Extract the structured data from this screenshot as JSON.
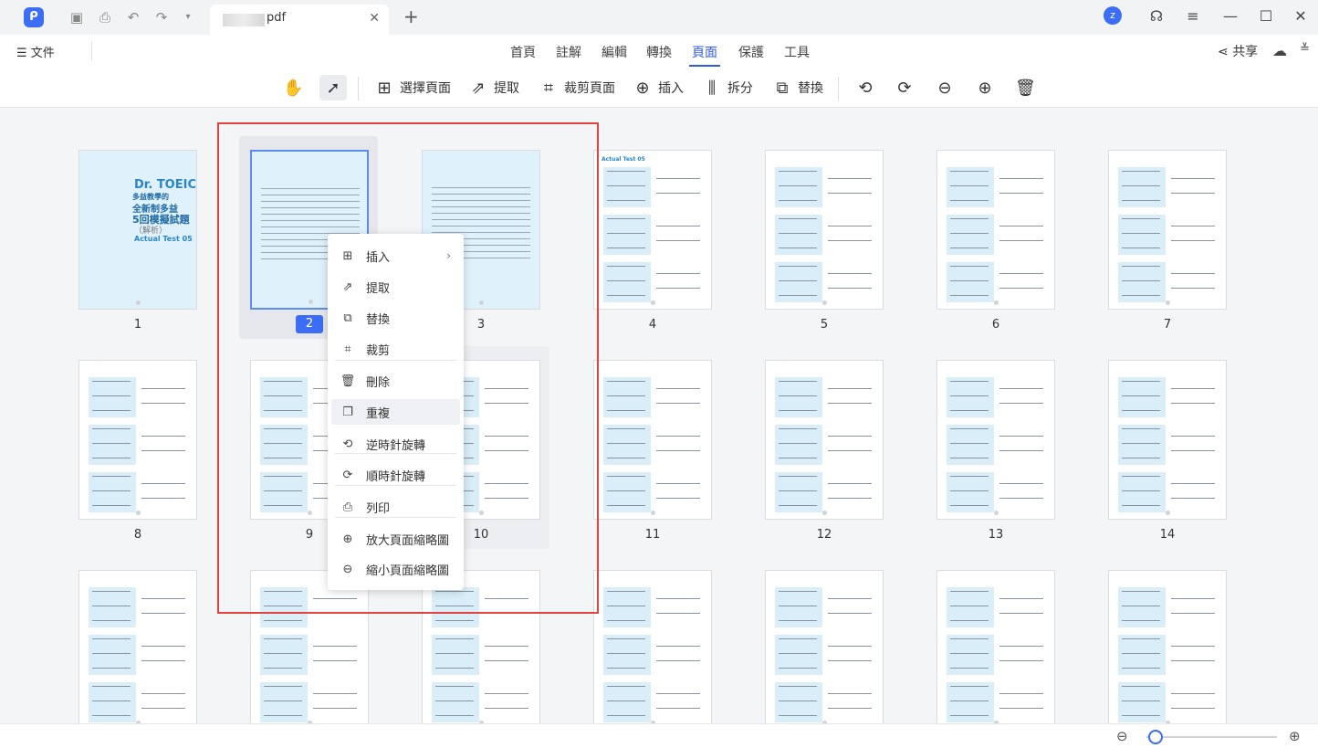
{
  "titlebar": {
    "tab_title": "pdf",
    "avatar_letter": "z"
  },
  "menubar": {
    "file": "文件",
    "nav": [
      "首頁",
      "註解",
      "編輯",
      "轉換",
      "頁面",
      "保護",
      "工具"
    ],
    "active_nav": "頁面",
    "share": "共享"
  },
  "toolbar": {
    "select_pages": "選擇頁面",
    "extract": "提取",
    "crop_pages": "裁剪頁面",
    "insert": "插入",
    "split": "拆分",
    "replace": "替換"
  },
  "pages": [
    "1",
    "2",
    "3",
    "4",
    "5",
    "6",
    "7",
    "8",
    "9",
    "10",
    "11",
    "12",
    "13",
    "14"
  ],
  "selected_page": "2",
  "cover": {
    "title": "Dr. TOEIC",
    "line1": "多益教學的",
    "line2": "全新制多益",
    "line3": "5回模擬試題",
    "tag": "（解析）",
    "test": "Actual Test 05"
  },
  "page4_label": "Actual Test 05",
  "context_menu": [
    {
      "label": "插入",
      "icon": "insert-icon",
      "submenu": true
    },
    {
      "label": "提取",
      "icon": "extract-icon"
    },
    {
      "label": "替換",
      "icon": "replace-icon"
    },
    {
      "label": "裁剪",
      "icon": "crop-icon"
    },
    {
      "label": "刪除",
      "icon": "delete-icon"
    },
    {
      "label": "重複",
      "icon": "duplicate-icon"
    },
    {
      "label": "逆時針旋轉",
      "icon": "rotate-ccw-icon"
    },
    {
      "label": "順時針旋轉",
      "icon": "rotate-cw-icon"
    },
    {
      "label": "列印",
      "icon": "print-icon"
    },
    {
      "label": "放大頁面縮略圖",
      "icon": "zoom-in-icon"
    },
    {
      "label": "縮小頁面縮略圖",
      "icon": "zoom-out-icon"
    }
  ],
  "zoom_level": 0.07,
  "colors": {
    "accent": "#3b6df5",
    "highlight_box": "#e0443f",
    "page_tint": "#dff1fb"
  }
}
